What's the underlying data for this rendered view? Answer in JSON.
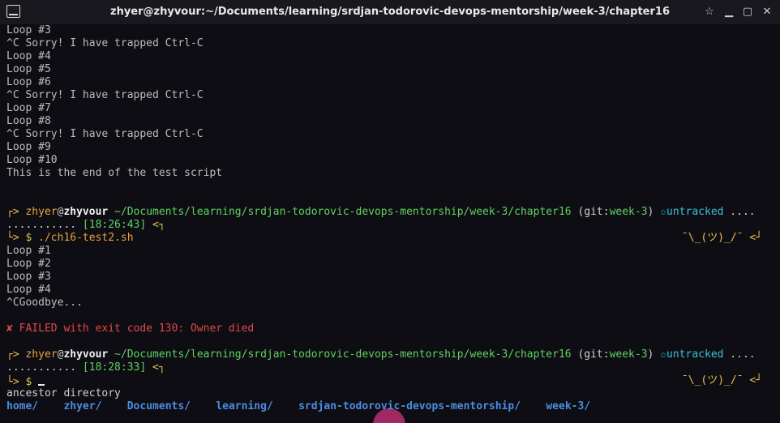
{
  "window": {
    "title": "zhyer@zhyvour:~/Documents/learning/srdjan-todorovic-devops-mentorship/week-3/chapter16",
    "buttons": {
      "restore": "☆",
      "minimize": "▁",
      "maximize": "▢",
      "close": "✕"
    }
  },
  "output1": [
    "Loop #3",
    "^C Sorry! I have trapped Ctrl-C",
    "Loop #4",
    "Loop #5",
    "Loop #6",
    "^C Sorry! I have trapped Ctrl-C",
    "Loop #7",
    "Loop #8",
    "^C Sorry! I have trapped Ctrl-C",
    "Loop #9",
    "Loop #10",
    "This is the end of the test script"
  ],
  "prompt1": {
    "corner": "┌>",
    "user": "zhyer",
    "at": "@",
    "host": "zhyvour",
    "path": "~/Documents/learning/srdjan-todorovic-devops-mentorship/week-3/chapter16",
    "git_open": "(git:",
    "branch": "week-3",
    "git_close": ")",
    "status_icon": "✩",
    "status": "untracked",
    "dots_end": " ....",
    "dots": "...........",
    "time": "[18:26:43]",
    "arrow": "<┐",
    "corner2": "└>",
    "dollar": "$",
    "command": "./ch16-test2.sh",
    "shrug": "¯\\_(ツ)_/¯",
    "shrug_arrow": "<┘"
  },
  "output2": [
    "Loop #1",
    "Loop #2",
    "Loop #3",
    "Loop #4",
    "^CGoodbye..."
  ],
  "error": "✘ FAILED with exit code 130: Owner died",
  "prompt2": {
    "corner": "┌>",
    "user": "zhyer",
    "at": "@",
    "host": "zhyvour",
    "path": "~/Documents/learning/srdjan-todorovic-devops-mentorship/week-3/chapter16",
    "git_open": "(git:",
    "branch": "week-3",
    "git_close": ")",
    "status_icon": "✩",
    "status": "untracked",
    "dots_end": " ....",
    "dots": "...........",
    "time": "[18:28:33]",
    "arrow": "<┐",
    "corner2": "└>",
    "dollar": "$",
    "shrug": "¯\\_(ツ)_/¯",
    "shrug_arrow": "<┘"
  },
  "completion": {
    "label": "ancestor directory",
    "items": [
      "home/",
      "zhyer/",
      "Documents/",
      "learning/",
      "srdjan-todorovic-devops-mentorship/",
      "week-3/"
    ]
  }
}
